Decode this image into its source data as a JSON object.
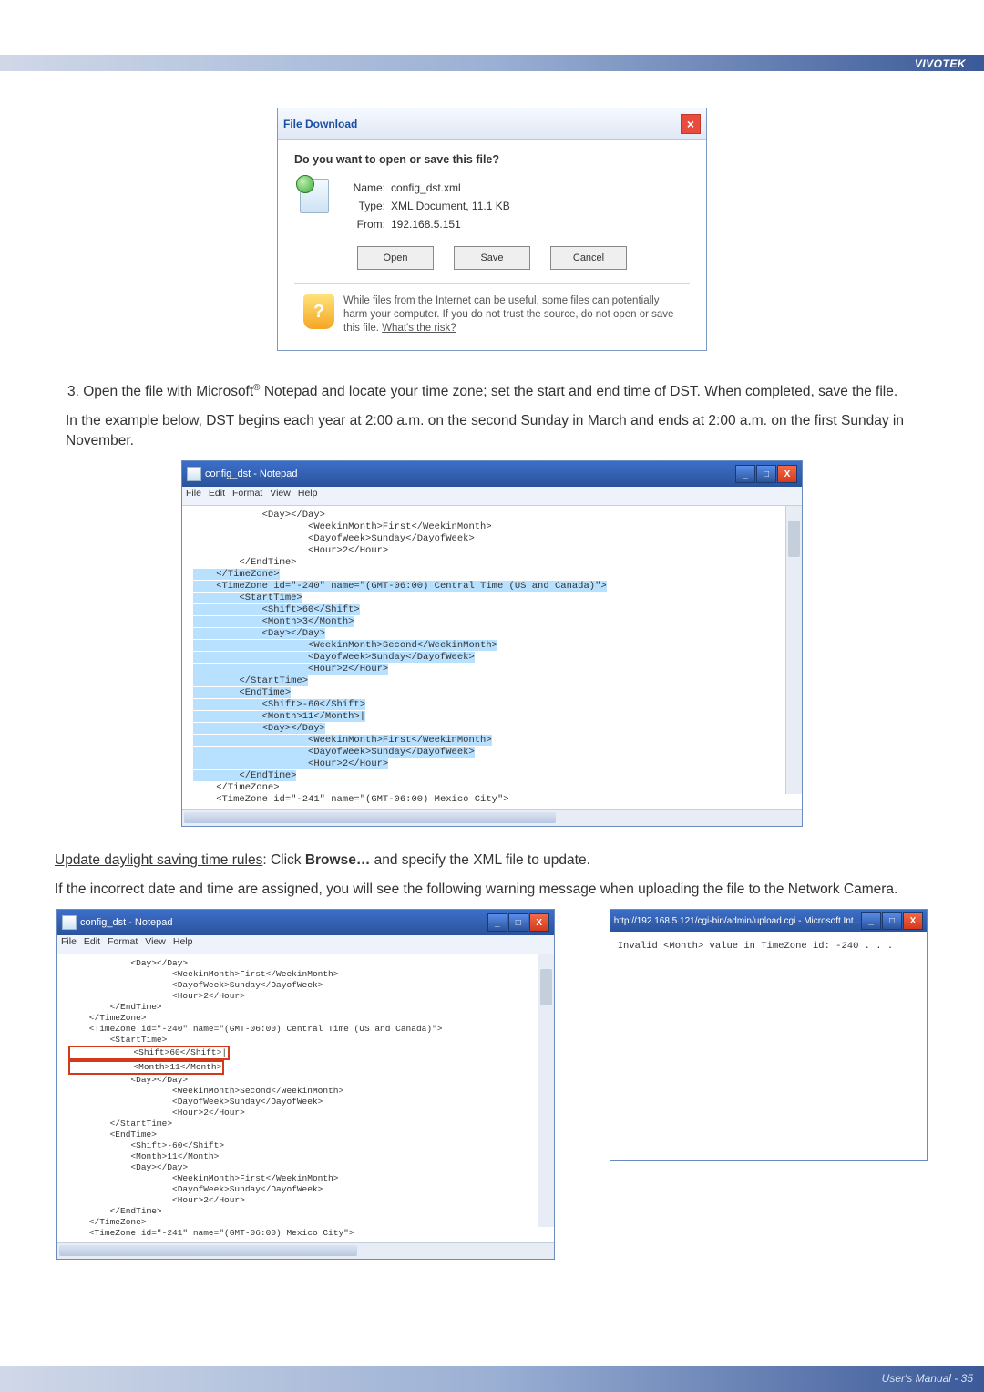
{
  "header": {
    "brand": "VIVOTEK"
  },
  "file_download": {
    "title": "File Download",
    "prompt": "Do you want to open or save this file?",
    "name_label": "Name:",
    "name_value": "config_dst.xml",
    "type_label": "Type:",
    "type_value": "XML Document, 11.1 KB",
    "from_label": "From:",
    "from_value": "192.168.5.151",
    "open_btn": "Open",
    "save_btn": "Save",
    "cancel_btn": "Cancel",
    "warning": "While files from the Internet can be useful, some files can potentially harm your computer. If you do not trust the source, do not open or save this file. ",
    "warning_link": "What's the risk?"
  },
  "step3": {
    "prefix": "3. Open the file with Microsoft",
    "suffix": " Notepad and locate your time zone; set the start and end time of DST. When completed, save the file.",
    "example": "In the example below, DST begins each year at 2:00 a.m. on the second Sunday in March and ends at 2:00 a.m. on the first Sunday in November."
  },
  "notepad": {
    "title": "config_dst - Notepad",
    "menu_file": "File",
    "menu_edit": "Edit",
    "menu_format": "Format",
    "menu_view": "View",
    "menu_help": "Help",
    "content_pre": "            <Day></Day>\n                    <WeekinMonth>First</WeekinMonth>\n                    <DayofWeek>Sunday</DayofWeek>\n                    <Hour>2</Hour>\n        </EndTime>",
    "content_main": "    </TimeZone>\n    <TimeZone id=\"-240\" name=\"(GMT-06:00) Central Time (US and Canada)\">\n        <StartTime>\n            <Shift>60</Shift>\n            <Month>3</Month>\n            <Day></Day>\n                    <WeekinMonth>Second</WeekinMonth>\n                    <DayofWeek>Sunday</DayofWeek>\n                    <Hour>2</Hour>\n        </StartTime>\n        <EndTime>\n            <Shift>-60</Shift>\n            <Month>11</Month>|\n            <Day></Day>\n                    <WeekinMonth>First</WeekinMonth>\n                    <DayofWeek>Sunday</DayofWeek>\n                    <Hour>2</Hour>\n        </EndTime>",
    "content_post": "    </TimeZone>\n    <TimeZone id=\"-241\" name=\"(GMT-06:00) Mexico City\">"
  },
  "update_text": {
    "prefix": "Update daylight saving time rules",
    "mid": ": Click ",
    "browse": "Browse…",
    "suffix": " and specify the XML file to update."
  },
  "warning_text": "If the incorrect date and time are assigned, you will see the following warning message when uploading the file to the Network Camera.",
  "notepad2": {
    "line1": "            <Day></Day>\n                    <WeekinMonth>First</WeekinMonth>\n                    <DayofWeek>Sunday</DayofWeek>\n                    <Hour>2</Hour>\n        </EndTime>\n    </TimeZone>\n    <TimeZone id=\"-240\" name=\"(GMT-06:00) Central Time (US and Canada)\">\n        <StartTime>",
    "box1": "            <Shift>60</Shift>|",
    "box2": "            <Month>11</Month>",
    "line2": "            <Day></Day>\n                    <WeekinMonth>Second</WeekinMonth>\n                    <DayofWeek>Sunday</DayofWeek>\n                    <Hour>2</Hour>\n        </StartTime>\n        <EndTime>\n            <Shift>-60</Shift>\n            <Month>11</Month>\n            <Day></Day>\n                    <WeekinMonth>First</WeekinMonth>\n                    <DayofWeek>Sunday</DayofWeek>\n                    <Hour>2</Hour>\n        </EndTime>\n    </TimeZone>\n    <TimeZone id=\"-241\" name=\"(GMT-06:00) Mexico City\">"
  },
  "ie": {
    "title": "http://192.168.5.121/cgi-bin/admin/upload.cgi - Microsoft Int...",
    "body": "Invalid <Month> value in TimeZone id: -240 . . ."
  },
  "footer": {
    "text": "User's Manual - 35"
  }
}
